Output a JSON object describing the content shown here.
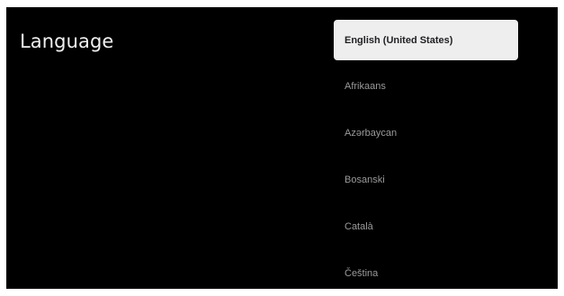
{
  "page": {
    "title": "Language"
  },
  "languages": {
    "items": [
      {
        "label": "English (United States)",
        "selected": true
      },
      {
        "label": "Afrikaans",
        "selected": false
      },
      {
        "label": "Azərbaycan",
        "selected": false
      },
      {
        "label": "Bosanski",
        "selected": false
      },
      {
        "label": "Català",
        "selected": false
      },
      {
        "label": "Čeština",
        "selected": false
      }
    ]
  },
  "colors": {
    "background": "#000000",
    "selected_bg": "#eeeeee",
    "selected_text": "#202124",
    "item_text": "#9a9a9a",
    "title_text": "#f1f1f1"
  }
}
